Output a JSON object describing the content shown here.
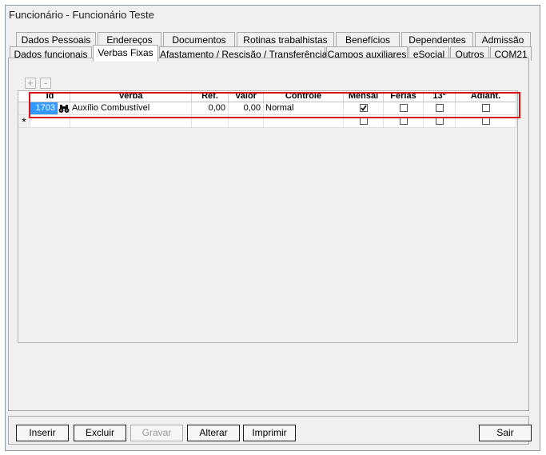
{
  "window": {
    "title": "Funcionário - Funcionário Teste"
  },
  "tabs": {
    "row1": [
      "Dados Pessoais",
      "Endereços",
      "Documentos",
      "Rotinas trabalhistas",
      "Benefícios",
      "Dependentes",
      "Admissão"
    ],
    "row2": [
      "Dados funcionais",
      "Verbas Fixas",
      "Afastamento / Rescisão / Transferência",
      "Campos auxiliares",
      "eSocial",
      "Outros",
      "COM21"
    ],
    "active": "Verbas Fixas"
  },
  "grid_toolbar": {
    "add_label": "+",
    "remove_label": "-"
  },
  "grid": {
    "columns": [
      "Id",
      "Verba",
      "Ref.",
      "Valor",
      "Controle",
      "Mensal",
      "Férias",
      "13º",
      "Adiant."
    ],
    "rows": [
      {
        "id": "1703",
        "verba": "Auxílio Combustível",
        "ref": "0,00",
        "valor": "0,00",
        "controle": "Normal",
        "mensal": true,
        "ferias": false,
        "decimo": false,
        "adiant": false
      }
    ],
    "new_row_marker": "*"
  },
  "buttons": {
    "inserir": "Inserir",
    "excluir": "Excluir",
    "gravar": "Gravar",
    "alterar": "Alterar",
    "imprimir": "Imprimir",
    "sair": "Sair"
  },
  "colors": {
    "highlight": "#d9121a",
    "selected_cell": "#3399ff"
  }
}
